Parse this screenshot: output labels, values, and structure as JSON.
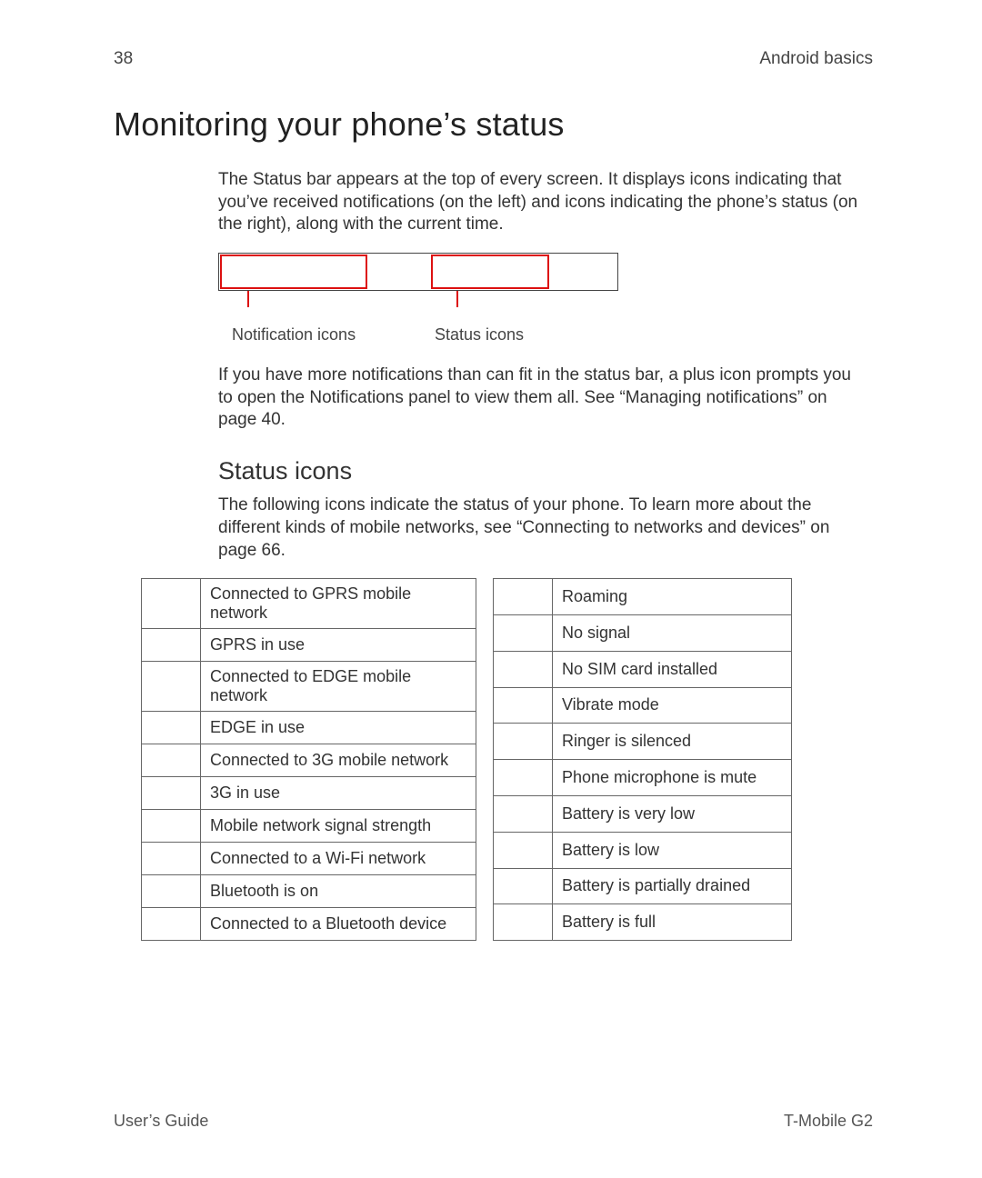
{
  "header": {
    "page_number": "38",
    "section": "Android basics"
  },
  "title": "Monitoring your phone’s status",
  "intro": "The Status bar appears at the top of every screen. It displays icons indicating that you’ve received notifications (on the left) and icons indicating the phone’s status (on the right), along with the current time.",
  "diagram": {
    "left_label": "Notification icons",
    "right_label": "Status icons"
  },
  "overflow_note": "If you have more notifications than can fit in the status bar, a plus icon       prompts you to open the Notifications panel to view them all. See “Managing notifications” on page 40.",
  "subsection_title": "Status icons",
  "subsection_intro": "The following icons indicate the status of your phone. To learn more about the different kinds of mobile networks, see “Connecting to networks and devices” on page 66.",
  "table_left": [
    "Connected to GPRS mobile network",
    "GPRS in use",
    "Connected to EDGE mobile network",
    "EDGE in use",
    "Connected to 3G mobile network",
    "3G in use",
    "Mobile network signal strength",
    "Connected to a Wi-Fi network",
    "Bluetooth is on",
    "Connected to a Bluetooth device"
  ],
  "table_right": [
    "Roaming",
    "No signal",
    "No SIM card installed",
    "Vibrate mode",
    "Ringer is silenced",
    "Phone microphone is mute",
    "Battery is very low",
    "Battery is low",
    "Battery is partially drained",
    "Battery is full"
  ],
  "footer": {
    "left": "User’s Guide",
    "right": "T-Mobile G2"
  }
}
